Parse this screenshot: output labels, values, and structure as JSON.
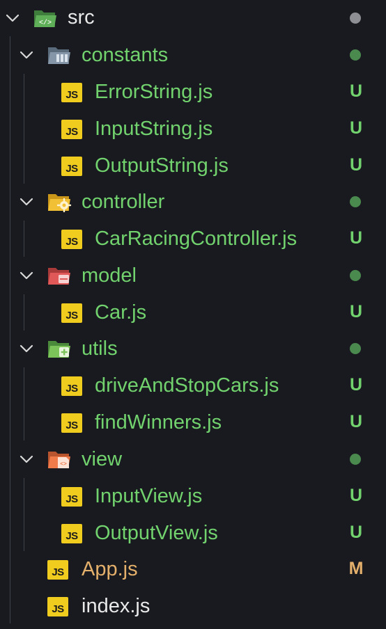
{
  "colors": {
    "background": "#181a1f",
    "untracked_green": "#72d36e",
    "modified_amber": "#e4b06b",
    "default_text": "#e9e9ea",
    "dot_green": "#4b8a4f",
    "dot_gray": "#8d8f94",
    "js_yellow": "#f0cc1e"
  },
  "tree": {
    "root": {
      "label": "src",
      "icon": "folder-src-open-icon",
      "status_dot": "gray"
    },
    "folders": [
      {
        "label": "constants",
        "icon": "folder-constants-open-icon",
        "status_dot": "green",
        "files": [
          {
            "label": "ErrorString.js",
            "status": "U"
          },
          {
            "label": "InputString.js",
            "status": "U"
          },
          {
            "label": "OutputString.js",
            "status": "U"
          }
        ]
      },
      {
        "label": "controller",
        "icon": "folder-controller-open-icon",
        "status_dot": "green",
        "files": [
          {
            "label": "CarRacingController.js",
            "status": "U"
          }
        ]
      },
      {
        "label": "model",
        "icon": "folder-model-open-icon",
        "status_dot": "green",
        "files": [
          {
            "label": "Car.js",
            "status": "U"
          }
        ]
      },
      {
        "label": "utils",
        "icon": "folder-utils-open-icon",
        "status_dot": "green",
        "files": [
          {
            "label": "driveAndStopCars.js",
            "status": "U"
          },
          {
            "label": "findWinners.js",
            "status": "U"
          }
        ]
      },
      {
        "label": "view",
        "icon": "folder-view-open-icon",
        "status_dot": "green",
        "files": [
          {
            "label": "InputView.js",
            "status": "U"
          },
          {
            "label": "OutputView.js",
            "status": "U"
          }
        ]
      }
    ],
    "root_files": [
      {
        "label": "App.js",
        "status": "M"
      },
      {
        "label": "index.js",
        "status": ""
      }
    ],
    "js_badge": "JS"
  }
}
